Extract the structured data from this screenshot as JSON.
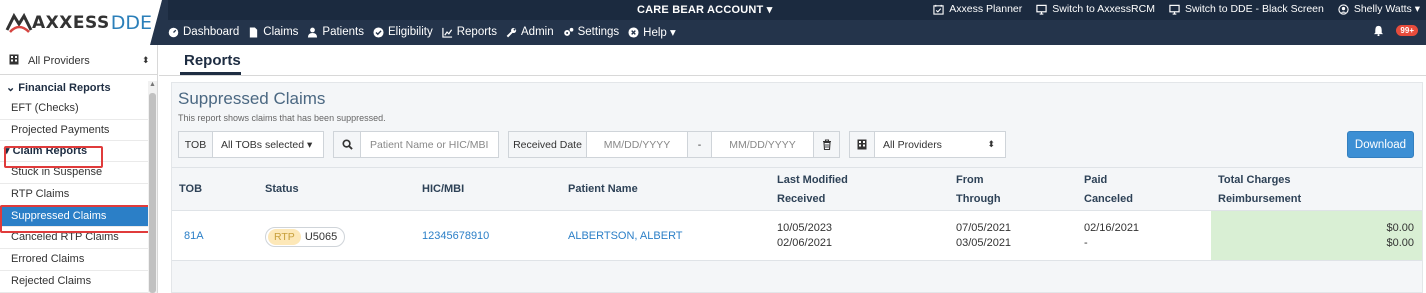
{
  "logo": {
    "word1": "AXXESS",
    "word2": "DDE"
  },
  "account": {
    "name": "CARE BEAR ACCOUNT ▾"
  },
  "utility_links": [
    {
      "label": "Axxess Planner",
      "icon": "calendar-check-icon"
    },
    {
      "label": "Switch to AxxessRCM",
      "icon": "monitor-icon"
    },
    {
      "label": "Switch to DDE - Black Screen",
      "icon": "monitor-icon"
    },
    {
      "label": "Shelly Watts ▾",
      "icon": "user-circle-icon"
    }
  ],
  "nav": [
    {
      "label": "Dashboard",
      "icon": "dashboard-icon"
    },
    {
      "label": "Claims",
      "icon": "document-icon"
    },
    {
      "label": "Patients",
      "icon": "user-icon"
    },
    {
      "label": "Eligibility",
      "icon": "check-circle-icon"
    },
    {
      "label": "Reports",
      "icon": "chart-icon"
    },
    {
      "label": "Admin",
      "icon": "wrench-icon"
    },
    {
      "label": "Settings",
      "icon": "gears-icon"
    },
    {
      "label": "Help ▾",
      "icon": "help-icon"
    }
  ],
  "notifications": {
    "count": "99+",
    "icon": "bell-icon"
  },
  "sidebar": {
    "provider_select": "All Providers",
    "section_financial": "Financial Reports",
    "financial_items": [
      "EFT (Checks)",
      "Projected Payments"
    ],
    "section_claims": "Claim Reports",
    "claim_items": [
      "Stuck in Suspense",
      "RTP Claims",
      "Suppressed Claims",
      "Canceled RTP Claims",
      "Errored Claims",
      "Rejected Claims"
    ],
    "active_item": "Suppressed Claims"
  },
  "page": {
    "tab": "Reports",
    "title": "Suppressed Claims",
    "subtitle": "This report shows claims that has been suppressed."
  },
  "filters": {
    "tob_label": "TOB",
    "tob_value": "All TOBs selected ▾",
    "search_placeholder": "Patient Name or HIC/MBI",
    "received_label": "Received Date",
    "date_from_placeholder": "MM/DD/YYYY",
    "date_sep": "-",
    "date_to_placeholder": "MM/DD/YYYY",
    "providers_value": "All Providers",
    "download_label": "Download"
  },
  "table": {
    "headers": {
      "tob": "TOB",
      "status": "Status",
      "hic": "HIC/MBI",
      "patient": "Patient Name",
      "modified_1": "Last Modified",
      "modified_2": "Received",
      "from_1": "From",
      "from_2": "Through",
      "paid_1": "Paid",
      "paid_2": "Canceled",
      "total_1": "Total Charges",
      "total_2": "Reimbursement"
    },
    "rows": [
      {
        "tob": "81A",
        "status_badge": "RTP",
        "status_code": "U5065",
        "hic": "12345678910",
        "patient": "ALBERTSON, ALBERT",
        "last_modified": "10/05/2023",
        "received": "02/06/2021",
        "from": "07/05/2021",
        "through": "03/05/2021",
        "paid": "02/16/2021",
        "canceled": "-",
        "total_charges": "$0.00",
        "reimbursement": "$0.00"
      }
    ]
  },
  "colors": {
    "nav_dark": "#1b2a3f",
    "accent_blue": "#2b7fc7",
    "highlight_red": "#e03b3b",
    "total_green": "#d9efd4",
    "rtp_badge": "#fde8b8"
  }
}
